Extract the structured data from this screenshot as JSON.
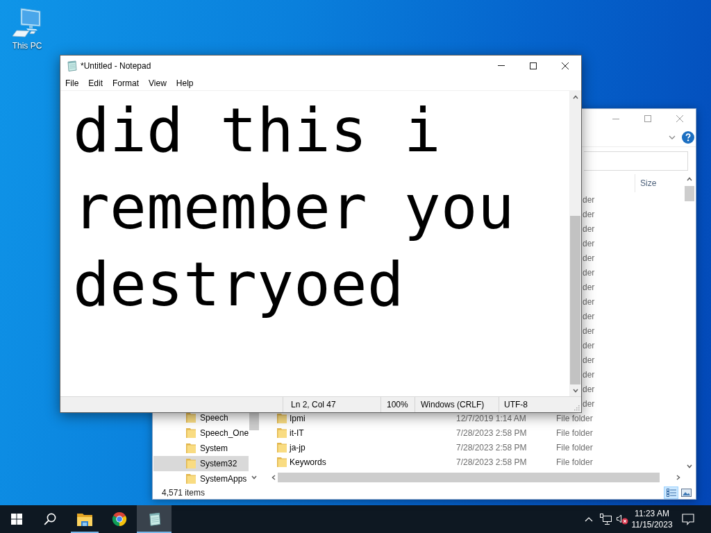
{
  "desktop": {
    "icons": [
      {
        "label": "This PC"
      }
    ]
  },
  "explorer_window": {
    "active": false,
    "columns": [
      {
        "label": "Size"
      }
    ],
    "nav_items": [
      {
        "label": "Speech",
        "selected": false
      },
      {
        "label": "Speech_One",
        "selected": false
      },
      {
        "label": "System",
        "selected": false
      },
      {
        "label": "System32",
        "selected": true
      },
      {
        "label": "SystemApps",
        "selected": false
      }
    ],
    "covered_rows": [
      {
        "type": "der"
      },
      {
        "type": "der"
      },
      {
        "type": "der"
      },
      {
        "type": "der"
      },
      {
        "type": "der"
      },
      {
        "type": "der"
      },
      {
        "type": "der"
      },
      {
        "type": "der"
      },
      {
        "type": "der"
      },
      {
        "type": "der"
      },
      {
        "type": "der"
      },
      {
        "type": "der"
      },
      {
        "type": "der"
      },
      {
        "type": "der"
      },
      {
        "type": "der"
      }
    ],
    "rows": [
      {
        "name": "Ipmi",
        "date_modified": "12/7/2019 1:14 AM",
        "type": "File folder"
      },
      {
        "name": "it-IT",
        "date_modified": "7/28/2023 2:58 PM",
        "type": "File folder"
      },
      {
        "name": "ja-jp",
        "date_modified": "7/28/2023 2:58 PM",
        "type": "File folder"
      },
      {
        "name": "Keywords",
        "date_modified": "7/28/2023 2:58 PM",
        "type": "File folder"
      }
    ],
    "status": "4,571 items",
    "view_buttons": [
      {
        "kind": "details",
        "selected": true
      },
      {
        "kind": "large_icons",
        "selected": false
      }
    ]
  },
  "notepad_window": {
    "active": true,
    "title": "*Untitled - Notepad",
    "menu": [
      "File",
      "Edit",
      "Format",
      "View",
      "Help"
    ],
    "text": "did this i remember you destryoed",
    "status_bar": [
      "Ln 2, Col 47",
      "100%",
      "Windows (CRLF)",
      "UTF-8"
    ]
  },
  "taskbar": {
    "apps": [
      {
        "kind": "file_explorer",
        "running": true,
        "active": false
      },
      {
        "kind": "chrome",
        "running": false,
        "active": false
      },
      {
        "kind": "notepad",
        "running": true,
        "active": true
      }
    ],
    "tray": {
      "volume_muted": true
    },
    "clock": {
      "time": "11:23 AM",
      "date": "11/15/2023"
    }
  }
}
